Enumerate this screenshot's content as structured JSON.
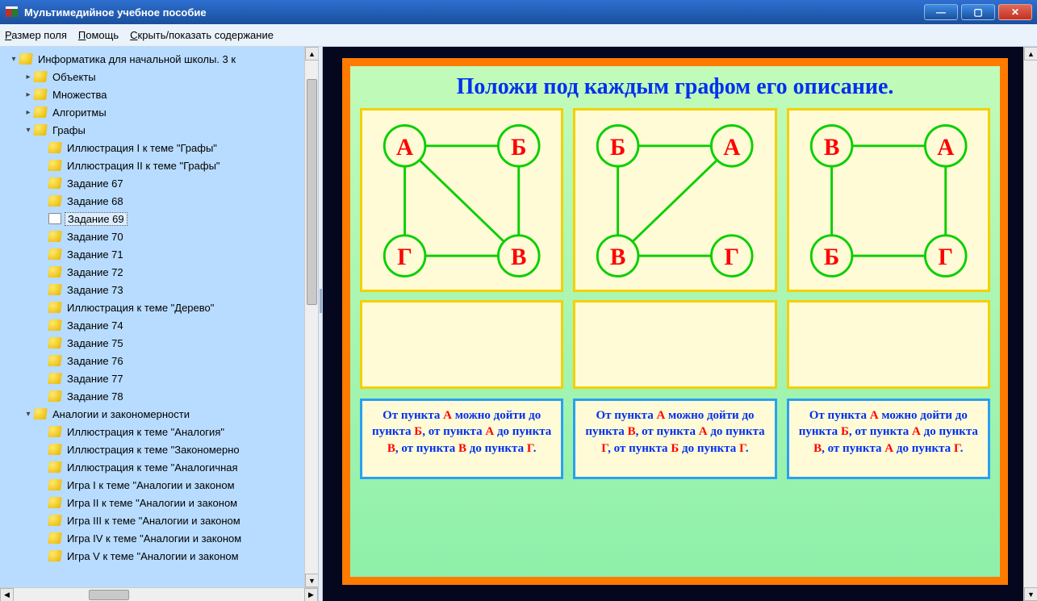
{
  "window": {
    "title": "Мультимедийное учебное пособие"
  },
  "menu": {
    "size": "Размер поля",
    "size_u": "Р",
    "help": "Помощь",
    "help_u": "П",
    "toggle": "Скрыть/показать содержание",
    "toggle_u": "С"
  },
  "tree": [
    {
      "depth": 0,
      "twisty": "▾",
      "icon": "book",
      "label": "Информатика для начальной школы. 3 к"
    },
    {
      "depth": 1,
      "twisty": "▸",
      "icon": "book",
      "label": "Объекты"
    },
    {
      "depth": 1,
      "twisty": "▸",
      "icon": "book",
      "label": "Множества"
    },
    {
      "depth": 1,
      "twisty": "▸",
      "icon": "book",
      "label": "Алгоритмы"
    },
    {
      "depth": 1,
      "twisty": "▾",
      "icon": "book",
      "label": "Графы"
    },
    {
      "depth": 2,
      "twisty": "",
      "icon": "book",
      "label": "Иллюстрация I к теме \"Графы\""
    },
    {
      "depth": 2,
      "twisty": "",
      "icon": "book",
      "label": "Иллюстрация II к теме \"Графы\""
    },
    {
      "depth": 2,
      "twisty": "",
      "icon": "book",
      "label": "Задание 67"
    },
    {
      "depth": 2,
      "twisty": "",
      "icon": "book",
      "label": "Задание 68"
    },
    {
      "depth": 2,
      "twisty": "",
      "icon": "bookopen",
      "label": "Задание 69",
      "selected": true
    },
    {
      "depth": 2,
      "twisty": "",
      "icon": "book",
      "label": "Задание 70"
    },
    {
      "depth": 2,
      "twisty": "",
      "icon": "book",
      "label": "Задание 71"
    },
    {
      "depth": 2,
      "twisty": "",
      "icon": "book",
      "label": "Задание 72"
    },
    {
      "depth": 2,
      "twisty": "",
      "icon": "book",
      "label": "Задание 73"
    },
    {
      "depth": 2,
      "twisty": "",
      "icon": "book",
      "label": "Иллюстрация к теме \"Дерево\""
    },
    {
      "depth": 2,
      "twisty": "",
      "icon": "book",
      "label": "Задание 74"
    },
    {
      "depth": 2,
      "twisty": "",
      "icon": "book",
      "label": "Задание 75"
    },
    {
      "depth": 2,
      "twisty": "",
      "icon": "book",
      "label": "Задание 76"
    },
    {
      "depth": 2,
      "twisty": "",
      "icon": "book",
      "label": "Задание 77"
    },
    {
      "depth": 2,
      "twisty": "",
      "icon": "book",
      "label": "Задание 78"
    },
    {
      "depth": 1,
      "twisty": "▾",
      "icon": "book",
      "label": "Аналогии и закономерности"
    },
    {
      "depth": 2,
      "twisty": "",
      "icon": "book",
      "label": "Иллюстрация к теме \"Аналогия\""
    },
    {
      "depth": 2,
      "twisty": "",
      "icon": "book",
      "label": "Иллюстрация к теме \"Закономерно"
    },
    {
      "depth": 2,
      "twisty": "",
      "icon": "book",
      "label": "Иллюстрация к теме \"Аналогичная"
    },
    {
      "depth": 2,
      "twisty": "",
      "icon": "book",
      "label": "Игра I к теме \"Аналогии и законом"
    },
    {
      "depth": 2,
      "twisty": "",
      "icon": "book",
      "label": "Игра II к теме \"Аналогии и законом"
    },
    {
      "depth": 2,
      "twisty": "",
      "icon": "book",
      "label": "Игра III к теме \"Аналогии и законом"
    },
    {
      "depth": 2,
      "twisty": "",
      "icon": "book",
      "label": "Игра IV к теме \"Аналогии и законом"
    },
    {
      "depth": 2,
      "twisty": "",
      "icon": "book",
      "label": "Игра V к теме \"Аналогии и законом"
    }
  ],
  "task": {
    "title": "Положи под каждым графом его описание.",
    "graphs": [
      {
        "nodes": [
          "А",
          "Б",
          "Г",
          "В"
        ],
        "edges": [
          [
            0,
            1
          ],
          [
            0,
            2
          ],
          [
            2,
            3
          ],
          [
            1,
            3
          ],
          [
            0,
            3
          ]
        ]
      },
      {
        "nodes": [
          "Б",
          "А",
          "В",
          "Г"
        ],
        "edges": [
          [
            0,
            1
          ],
          [
            0,
            2
          ],
          [
            2,
            3
          ],
          [
            1,
            2
          ]
        ]
      },
      {
        "nodes": [
          "В",
          "А",
          "Б",
          "Г"
        ],
        "edges": [
          [
            0,
            1
          ],
          [
            1,
            3
          ],
          [
            2,
            3
          ],
          [
            0,
            2
          ]
        ]
      }
    ],
    "descriptions": [
      [
        {
          "t": "От пункта "
        },
        {
          "t": "А",
          "r": 1
        },
        {
          "t": " можно дойти до пункта "
        },
        {
          "t": "Б",
          "r": 1
        },
        {
          "t": ", от пункта "
        },
        {
          "t": "А",
          "r": 1
        },
        {
          "t": " до пункта "
        },
        {
          "t": "В",
          "r": 1
        },
        {
          "t": ", от пункта "
        },
        {
          "t": "В",
          "r": 1
        },
        {
          "t": " до пункта "
        },
        {
          "t": "Г",
          "r": 1
        },
        {
          "t": "."
        }
      ],
      [
        {
          "t": "От пункта "
        },
        {
          "t": "А",
          "r": 1
        },
        {
          "t": " можно дойти до пункта "
        },
        {
          "t": "В",
          "r": 1
        },
        {
          "t": ", от пункта "
        },
        {
          "t": "А",
          "r": 1
        },
        {
          "t": " до пункта "
        },
        {
          "t": "Г",
          "r": 1
        },
        {
          "t": ", от пункта "
        },
        {
          "t": "Б",
          "r": 1
        },
        {
          "t": " до пункта "
        },
        {
          "t": "Г",
          "r": 1
        },
        {
          "t": "."
        }
      ],
      [
        {
          "t": "От пункта "
        },
        {
          "t": "А",
          "r": 1
        },
        {
          "t": " можно дойти до пункта "
        },
        {
          "t": "Б",
          "r": 1
        },
        {
          "t": ", от пункта "
        },
        {
          "t": "А",
          "r": 1
        },
        {
          "t": " до пункта "
        },
        {
          "t": "В",
          "r": 1
        },
        {
          "t": ", от пункта "
        },
        {
          "t": "А",
          "r": 1
        },
        {
          "t": " до пункта "
        },
        {
          "t": "Г",
          "r": 1
        },
        {
          "t": "."
        }
      ]
    ]
  }
}
